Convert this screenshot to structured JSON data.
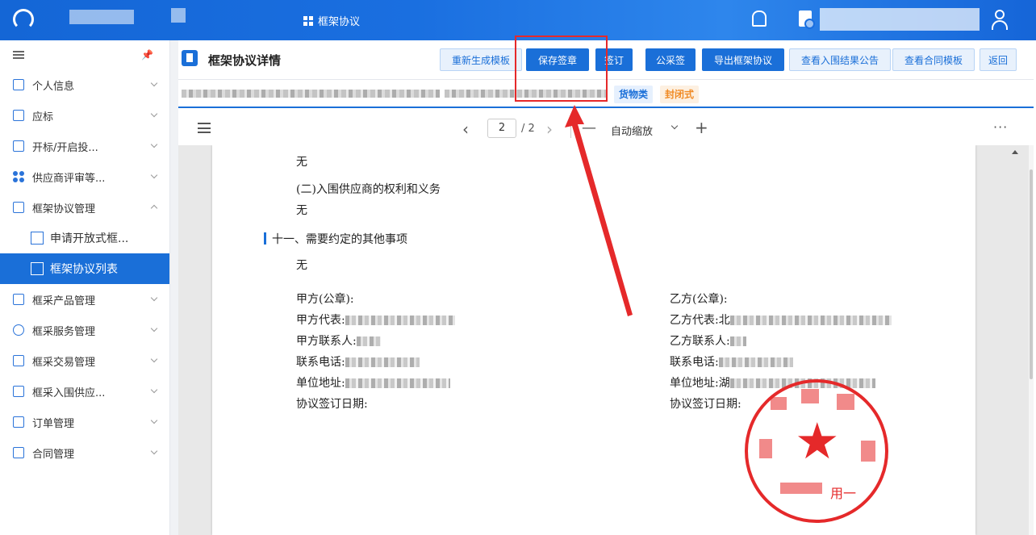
{
  "header": {
    "nav_title": "框架协议",
    "icons": [
      "logo-icon",
      "grid-icon",
      "bell-icon",
      "document-icon",
      "user-icon"
    ]
  },
  "sidebar": {
    "items": [
      {
        "label": "个人信息",
        "icon": "profile-icon",
        "expanded": false
      },
      {
        "label": "应标",
        "icon": "bid-icon",
        "expanded": false
      },
      {
        "label": "开标/开启投...",
        "icon": "opening-icon",
        "expanded": false
      },
      {
        "label": "供应商评审等...",
        "icon": "review-icon",
        "expanded": false
      },
      {
        "label": "框架协议管理",
        "icon": "agreement-icon",
        "expanded": true,
        "children": [
          {
            "label": "申请开放式框...",
            "active": false
          },
          {
            "label": "框架协议列表",
            "active": true
          }
        ]
      },
      {
        "label": "框采产品管理",
        "icon": "product-icon",
        "expanded": false
      },
      {
        "label": "框采服务管理",
        "icon": "service-icon",
        "expanded": false
      },
      {
        "label": "框采交易管理",
        "icon": "trade-icon",
        "expanded": false
      },
      {
        "label": "框采入围供应...",
        "icon": "supplier-icon",
        "expanded": false
      },
      {
        "label": "订单管理",
        "icon": "order-icon",
        "expanded": false
      },
      {
        "label": "合同管理",
        "icon": "contract-icon",
        "expanded": false
      }
    ]
  },
  "main": {
    "title": "框架协议详情",
    "buttons": {
      "regenerate": "重新生成模板",
      "save_seal": "保存签章",
      "sign": "签订",
      "public_seal": "公采签",
      "export": "导出框架协议",
      "view_result": "查看入围结果公告",
      "view_template": "查看合同模板",
      "back": "返回"
    },
    "tags": {
      "category": "货物类",
      "type": "封闭式"
    }
  },
  "viewer": {
    "page_current": "2",
    "page_total": "/ 2",
    "zoom": "自动缩放",
    "more": "···"
  },
  "document": {
    "line1": "无",
    "rights_heading": "(二)入围供应商的权利和义务",
    "line2": "无",
    "section_heading": "十一、需要约定的其他事项",
    "line3": "无",
    "party_a": {
      "seal": "甲方(公章):",
      "rep": "甲方代表:",
      "contact": "甲方联系人:",
      "phone": "联系电话:",
      "address": "单位地址:",
      "date": "协议签订日期:"
    },
    "party_b": {
      "seal": "乙方(公章):",
      "rep": "乙方代表:",
      "rep_prefix": "北",
      "contact": "乙方联系人:",
      "phone": "联系电话:",
      "address": "单位地址:",
      "address_prefix": "湖",
      "date": "协议签订日期:"
    },
    "stamp_text": "用一"
  },
  "colors": {
    "primary": "#1a6fd8",
    "seal_red": "#e5292a",
    "tag_orange": "#f08a24"
  }
}
